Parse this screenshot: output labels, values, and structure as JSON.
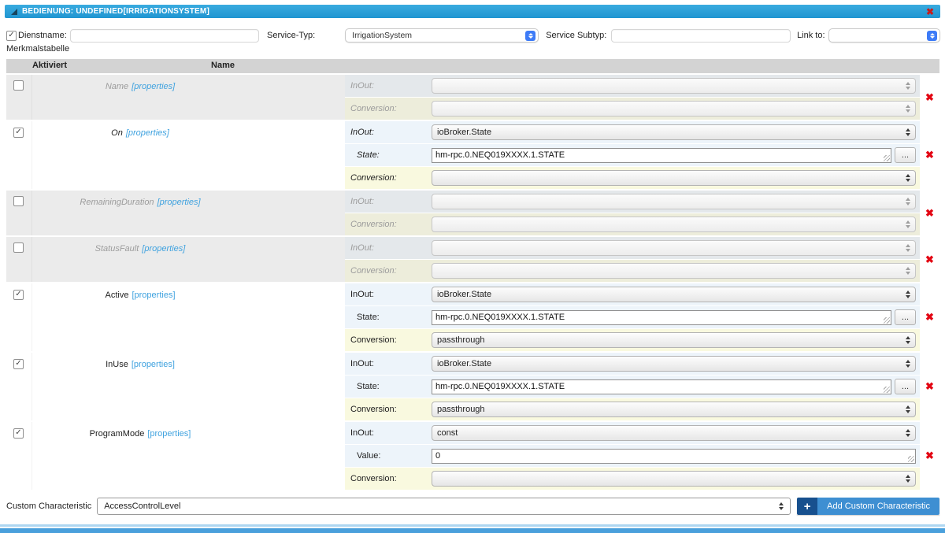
{
  "panel": {
    "title": "BEDIENUNG: UNDEFINED[IRRIGATIONSYSTEM]",
    "close_icon": "✖"
  },
  "form": {
    "dienstname": {
      "label": "Dienstname:",
      "checked": true,
      "value": ""
    },
    "service_typ": {
      "label": "Service-Typ:",
      "value": "IrrigationSystem"
    },
    "service_subtyp": {
      "label": "Service Subtyp:",
      "value": ""
    },
    "link_to": {
      "label": "Link to:",
      "value": ""
    }
  },
  "table": {
    "caption": "Merkmalstabelle",
    "headers": {
      "aktiviert": "Aktiviert",
      "name": "Name"
    },
    "properties_label": "[properties]",
    "delete_icon": "✖",
    "rows": [
      {
        "name": "Name",
        "checked": false,
        "enabled": false,
        "optional": true,
        "fields": [
          {
            "label": "InOut:",
            "control": "select",
            "value": "",
            "tone": "blue"
          },
          {
            "label": "Conversion:",
            "control": "select",
            "value": "",
            "tone": "yellow"
          }
        ]
      },
      {
        "name": "On",
        "checked": true,
        "enabled": true,
        "optional": true,
        "fields": [
          {
            "label": "InOut:",
            "control": "select",
            "value": "ioBroker.State",
            "tone": "blue"
          },
          {
            "label": "State:",
            "control": "textarea",
            "value": "hm-rpc.0.NEQ019XXXX.1.STATE",
            "tone": "blue",
            "indent": true,
            "ellipsis": "..."
          },
          {
            "label": "Conversion:",
            "control": "select",
            "value": "",
            "tone": "yellow"
          }
        ]
      },
      {
        "name": "RemainingDuration",
        "checked": false,
        "enabled": false,
        "optional": true,
        "fields": [
          {
            "label": "InOut:",
            "control": "select",
            "value": "",
            "tone": "blue"
          },
          {
            "label": "Conversion:",
            "control": "select",
            "value": "",
            "tone": "yellow"
          }
        ]
      },
      {
        "name": "StatusFault",
        "checked": false,
        "enabled": false,
        "optional": true,
        "fields": [
          {
            "label": "InOut:",
            "control": "select",
            "value": "",
            "tone": "blue"
          },
          {
            "label": "Conversion:",
            "control": "select",
            "value": "",
            "tone": "yellow"
          }
        ]
      },
      {
        "name": "Active",
        "checked": true,
        "enabled": true,
        "optional": false,
        "fields": [
          {
            "label": "InOut:",
            "control": "select",
            "value": "ioBroker.State",
            "tone": "blue"
          },
          {
            "label": "State:",
            "control": "textarea",
            "value": "hm-rpc.0.NEQ019XXXX.1.STATE",
            "tone": "blue",
            "indent": true,
            "ellipsis": "..."
          },
          {
            "label": "Conversion:",
            "control": "select",
            "value": "passthrough",
            "tone": "yellow"
          }
        ]
      },
      {
        "name": "InUse",
        "checked": true,
        "enabled": true,
        "optional": false,
        "fields": [
          {
            "label": "InOut:",
            "control": "select",
            "value": "ioBroker.State",
            "tone": "blue"
          },
          {
            "label": "State:",
            "control": "textarea",
            "value": "hm-rpc.0.NEQ019XXXX.1.STATE",
            "tone": "blue",
            "indent": true,
            "ellipsis": "..."
          },
          {
            "label": "Conversion:",
            "control": "select",
            "value": "passthrough",
            "tone": "yellow"
          }
        ]
      },
      {
        "name": "ProgramMode",
        "checked": true,
        "enabled": true,
        "optional": false,
        "fields": [
          {
            "label": "InOut:",
            "control": "select",
            "value": "const",
            "tone": "blue"
          },
          {
            "label": "Value:",
            "control": "textarea",
            "value": "0",
            "tone": "blue",
            "indent": true
          },
          {
            "label": "Conversion:",
            "control": "select",
            "value": "",
            "tone": "yellow"
          }
        ]
      }
    ]
  },
  "footer": {
    "custom_characteristic_label": "Custom Characteristic",
    "custom_characteristic_value": "AccessControlLevel",
    "add_plus": "+",
    "add_label": "Add Custom Characteristic"
  },
  "colors": {
    "header_blue": "#2a9fd8",
    "link_blue": "#3fa2df",
    "delete_red": "#e30613",
    "add_button_dark": "#17508e",
    "add_button_light": "#3e8fd2",
    "row_blue_bg": "#edf4fa",
    "row_yellow_bg": "#f9f9df",
    "disabled_bg": "#ebebeb",
    "table_header_bg": "#d3d3d3"
  }
}
